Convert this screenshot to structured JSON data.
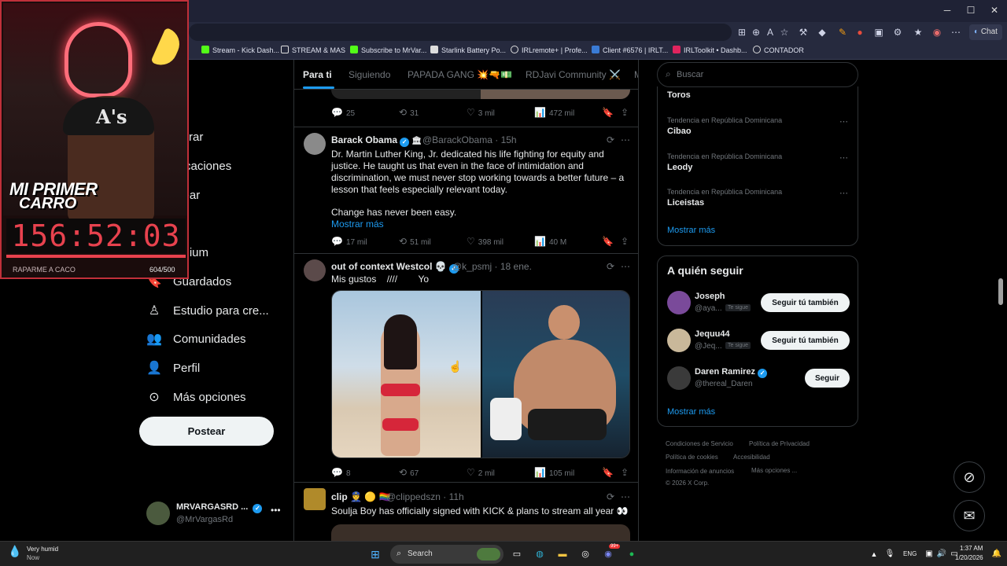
{
  "browser": {
    "chat_label": "Chat",
    "bookmarks": [
      "Stream - Kick Dash...",
      "STREAM & MAS",
      "Subscribe to MrVar...",
      "Starlink Battery Po...",
      "IRLremote+ | Profe...",
      "Client #6576 | IRLT...",
      "IRLToolkit • Dashb...",
      "CONTADOR"
    ]
  },
  "stream_overlay": {
    "promo_line1": "MI PRIMER",
    "promo_line2": "CARRO",
    "timer": "156:52:03",
    "goal_label": "RAPARME A CACO",
    "goal_count": "604/500",
    "goal_progress": 1.0
  },
  "nav": {
    "items": [
      {
        "label": "cio",
        "icon": "home-icon"
      },
      {
        "label": "plorar",
        "icon": "search-icon"
      },
      {
        "label": "tificaciones",
        "icon": "bell-icon"
      },
      {
        "label": "atear",
        "icon": "mail-icon"
      },
      {
        "label": "ok",
        "icon": "grok-icon"
      },
      {
        "label": "emium",
        "icon": "premium-icon"
      },
      {
        "label": "Guardados",
        "icon": "bookmark-icon"
      },
      {
        "label": "Estudio para cre...",
        "icon": "studio-icon"
      },
      {
        "label": "Comunidades",
        "icon": "communities-icon"
      },
      {
        "label": "Perfil",
        "icon": "profile-icon"
      },
      {
        "label": "Más opciones",
        "icon": "more-icon"
      }
    ],
    "post_button": "Postear",
    "account_name": "MRVARGASRD ...",
    "account_handle": "@MrVargasRd"
  },
  "feed": {
    "tabs": [
      "Para ti",
      "Siguiendo",
      "PAPADA GANG 💥🔫💵",
      "RDJavi Community ⚔️",
      "M"
    ],
    "prev_tweet_actions": {
      "replies": "25",
      "reposts": "31",
      "likes": "3 mil",
      "views": "472 mil"
    },
    "tweets": [
      {
        "name": "Barack Obama",
        "handle": "@BarackObama",
        "time": "· 15h",
        "text": "Dr. Martin Luther King, Jr. dedicated his life fighting for equity and justice. He taught us that even in the face of intimidation and discrimination, we must never stop working towards a better future – a lesson that feels especially relevant today.",
        "text2": "Change has never been easy.",
        "show_more": "Mostrar más",
        "replies": "17 mil",
        "reposts": "51 mil",
        "likes": "398 mil",
        "views": "40 M"
      },
      {
        "name": "out of context Westcol 💀",
        "handle": "@k_psmj",
        "time": "· 18 ene.",
        "text": "Mis gustos    ////        Yo",
        "replies": "8",
        "reposts": "67",
        "likes": "2 mil",
        "views": "105 mil"
      },
      {
        "name": "clip 👮 🟡 🏳️‍🌈",
        "handle": "@clippedszn",
        "time": "· 11h",
        "text": "Soulja Boy has officially signed with KICK & plans to stream all year 👀"
      }
    ]
  },
  "right": {
    "search_placeholder": "Buscar",
    "trends": [
      {
        "meta": "",
        "name": "Toros"
      },
      {
        "meta": "Tendencia en República Dominicana",
        "name": "Cibao"
      },
      {
        "meta": "Tendencia en República Dominicana",
        "name": "Leody"
      },
      {
        "meta": "Tendencia en República Dominicana",
        "name": "Liceistas"
      }
    ],
    "trends_more": "Mostrar más",
    "who_to_follow_title": "A quién seguir",
    "follows": [
      {
        "name": "Joseph",
        "handle": "@aya...",
        "badge": "Te sigue",
        "button": "Seguir tú también"
      },
      {
        "name": "Jequu44",
        "handle": "@Jeq...",
        "badge": "Te sigue",
        "button": "Seguir tú también"
      },
      {
        "name": "Daren Ramirez",
        "handle": "@thereal_Daren",
        "badge": "",
        "button": "Seguir"
      }
    ],
    "follow_more": "Mostrar más",
    "footer": [
      "Condiciones de Servicio",
      "Política de Privacidad",
      "Política de cookies",
      "Accesibilidad",
      "Información de anuncios",
      "Más opciones ...",
      "© 2026 X Corp."
    ]
  },
  "taskbar": {
    "weather_title": "Very humid",
    "weather_sub": "Now",
    "search_label": "Search",
    "badge_count": "99+",
    "lang": "ENG",
    "time": "1:37 AM",
    "date": "1/20/2026"
  },
  "colors": {
    "accent": "#1d9bf0",
    "timer": "#e8424e",
    "bg": "#000000"
  }
}
